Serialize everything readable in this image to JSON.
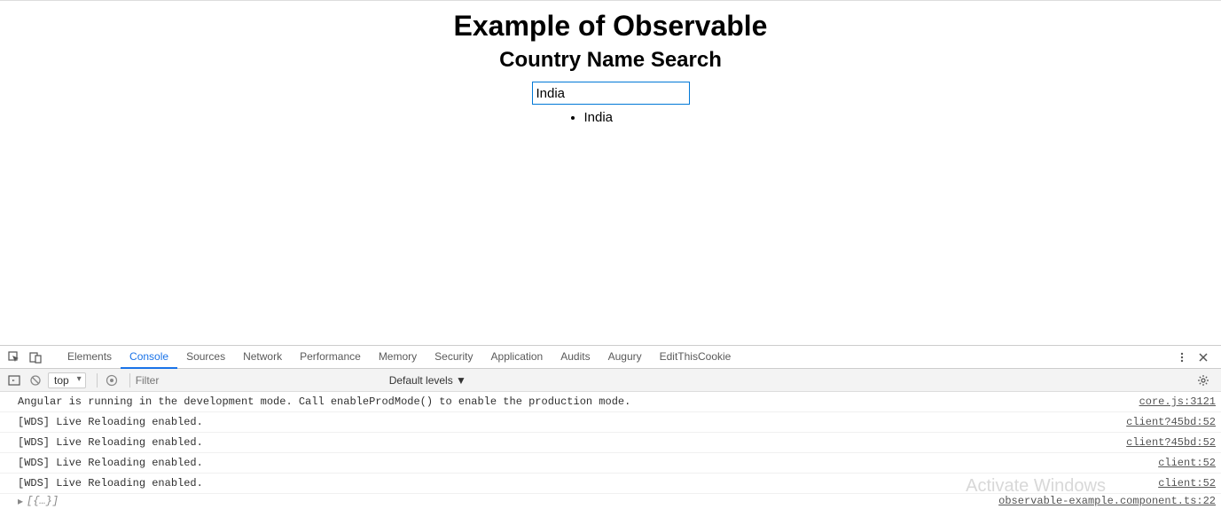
{
  "page": {
    "heading": "Example of Observable",
    "subheading": "Country Name Search",
    "search_value": "India",
    "results": [
      "India"
    ]
  },
  "devtools": {
    "tabs": [
      "Elements",
      "Console",
      "Sources",
      "Network",
      "Performance",
      "Memory",
      "Security",
      "Application",
      "Audits",
      "Augury",
      "EditThisCookie"
    ],
    "active_tab": "Console",
    "toolbar": {
      "context": "top",
      "filter_placeholder": "Filter",
      "levels_label": "Default levels ▼"
    },
    "logs": [
      {
        "message": "Angular is running in the development mode. Call enableProdMode() to enable the production mode.",
        "source": "core.js:3121"
      },
      {
        "message": "[WDS] Live Reloading enabled.",
        "source": "client?45bd:52"
      },
      {
        "message": "[WDS] Live Reloading enabled.",
        "source": "client?45bd:52"
      },
      {
        "message": "[WDS] Live Reloading enabled.",
        "source": "client:52"
      },
      {
        "message": "[WDS] Live Reloading enabled.",
        "source": "client:52"
      }
    ],
    "expand": {
      "preview": "[{…}]",
      "source": "observable-example.component.ts:22"
    }
  },
  "watermark": "Activate Windows"
}
